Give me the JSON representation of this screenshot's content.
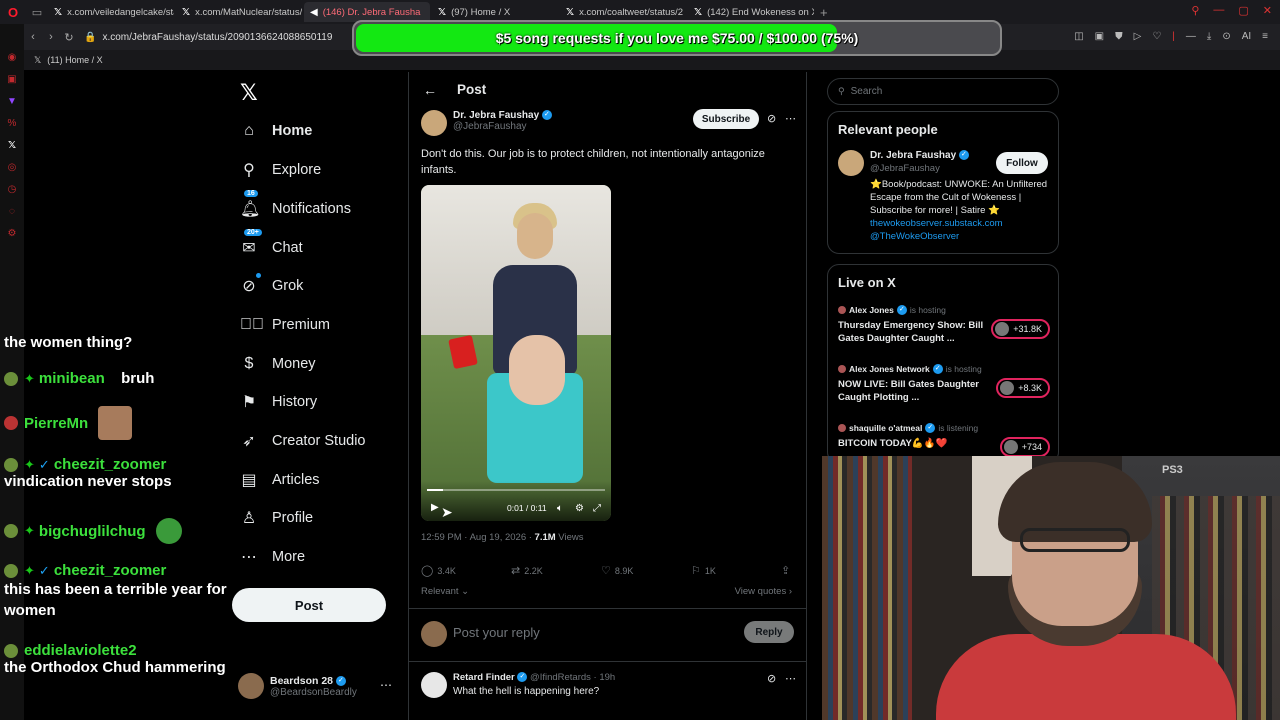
{
  "browser": {
    "tabs": [
      {
        "label": "x.com/veiledangelcake/sta"
      },
      {
        "label": "x.com/MatNuclear/status/"
      },
      {
        "label": "(146) Dr. Jebra Fausha",
        "active": true
      },
      {
        "label": "(97) Home / X"
      },
      {
        "label": "x.com/coaltweet/status/2"
      },
      {
        "label": "(142) End Wokeness on X"
      }
    ],
    "url": "x.com/JebraFaushay/status/2090136624088650119",
    "bookmark_label": "(11) Home / X"
  },
  "overlay": {
    "donation_text": "$5 song requests if you love me $75.00 / $100.00 (75%)",
    "donation_progress": 0.75,
    "fill_color": "#13e812"
  },
  "chat": [
    {
      "text": "the women thing?"
    },
    {
      "user": "minibean",
      "text": "bruh"
    },
    {
      "user": "PierreMn"
    },
    {
      "user": "cheezit_zoomer",
      "text": "vindication never stops"
    },
    {
      "user": "bigchuglilchug"
    },
    {
      "user": "cheezit_zoomer",
      "text": "this has been a terrible year for women"
    },
    {
      "user": "eddielaviolette2",
      "text": "the Orthodox Chud hammering"
    }
  ],
  "nav": {
    "items": [
      {
        "label": "Home",
        "icon": "home-icon"
      },
      {
        "label": "Explore",
        "icon": "search-icon"
      },
      {
        "label": "Notifications",
        "icon": "bell-icon",
        "badge": "16"
      },
      {
        "label": "Chat",
        "icon": "chat-icon",
        "badge": "20+"
      },
      {
        "label": "Grok",
        "icon": "grok-icon"
      },
      {
        "label": "Premium",
        "icon": "premium-icon"
      },
      {
        "label": "Money",
        "icon": "money-icon"
      },
      {
        "label": "History",
        "icon": "bookmark-icon"
      },
      {
        "label": "Creator Studio",
        "icon": "rocket-icon"
      },
      {
        "label": "Articles",
        "icon": "article-icon"
      },
      {
        "label": "Profile",
        "icon": "person-icon"
      },
      {
        "label": "More",
        "icon": "more-icon"
      }
    ],
    "post_label": "Post",
    "account": {
      "name": "Beardson 28",
      "handle": "@BeardsonBeardly"
    }
  },
  "post": {
    "header_title": "Post",
    "author_name": "Dr. Jebra Faushay",
    "author_handle": "@JebraFaushay",
    "subscribe_label": "Subscribe",
    "text": "Don't do this. Our job is to protect children, not intentionally antagonize infants.",
    "video": {
      "time": "0:01 / 0:11",
      "progress": 0.09
    },
    "timestamp": "12:59 PM · Aug 19, 2026 · ",
    "views_count": "7.1M",
    "views_label": " Views",
    "replies": "3.4K",
    "reposts": "2.2K",
    "likes": "8.9K",
    "bookmarks": "1K",
    "sort_label": "Relevant ⌄",
    "view_quotes": "View quotes ›",
    "reply_placeholder": "Post your reply",
    "reply_button": "Reply"
  },
  "first_reply": {
    "name": "Retard Finder",
    "handle": "@IfindRetards · 19h",
    "text": "What the hell is happening here?"
  },
  "sidebar": {
    "search_placeholder": "Search",
    "relevant_title": "Relevant people",
    "person": {
      "name": "Dr. Jebra Faushay",
      "handle": "@JebraFaushay",
      "follow_label": "Follow",
      "bio": "⭐Book/podcast: UNWOKE: An Unfiltered Escape from the Cult of Wokeness | Subscribe for more! | Satire ⭐",
      "link1": "thewokeobserver.substack.com",
      "link2": "@TheWokeObserver"
    },
    "live_title": "Live on X",
    "live": [
      {
        "host": "Alex Jones",
        "status": "is hosting",
        "title": "Thursday Emergency Show: Bill Gates Daughter Caught ...",
        "count": "+31.8K"
      },
      {
        "host": "Alex Jones Network",
        "status": "is hosting",
        "title": "NOW LIVE: Bill Gates Daughter Caught Plotting ...",
        "count": "+8.3K"
      },
      {
        "host": "shaquille o'atmeal",
        "status": "is listening",
        "title": "BITCOIN TODAY💪🔥❤️",
        "count": "+734"
      }
    ]
  }
}
